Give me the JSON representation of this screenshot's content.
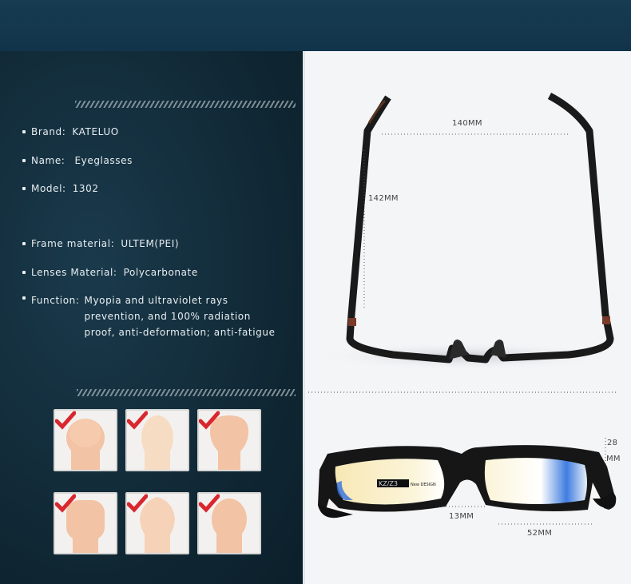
{
  "specs": {
    "brand": {
      "label": "Brand:",
      "value": "KATELUO"
    },
    "name": {
      "label": "Name:",
      "value": "Eyeglasses"
    },
    "model": {
      "label": "Model:",
      "value": "1302"
    },
    "frame": {
      "label": "Frame material:",
      "value": "ULTEM(PEI)"
    },
    "lenses": {
      "label": "Lenses Material:",
      "value": "Polycarbonate"
    },
    "function": {
      "label": "Function:",
      "value": "Myopia and ultraviolet rays prevention, and 100% radiation proof, anti-deformation; anti-fatigue"
    }
  },
  "dimensions": {
    "temple_width": "140MM",
    "temple_length": "142MM",
    "lens_height_a": "28",
    "lens_height_b": "MM",
    "bridge": "13MM",
    "lens_width": "52MM"
  },
  "frame_print": {
    "brand_mark": "KZ/Z3",
    "design": "New DESIGN"
  },
  "colors": {
    "panel_dark": "#0f2632",
    "check_red": "#d9272e",
    "skin": "#f2c3a4"
  },
  "face_icons": [
    "face-round",
    "face-oval",
    "face-heart",
    "face-square",
    "face-diamond",
    "face-long"
  ]
}
